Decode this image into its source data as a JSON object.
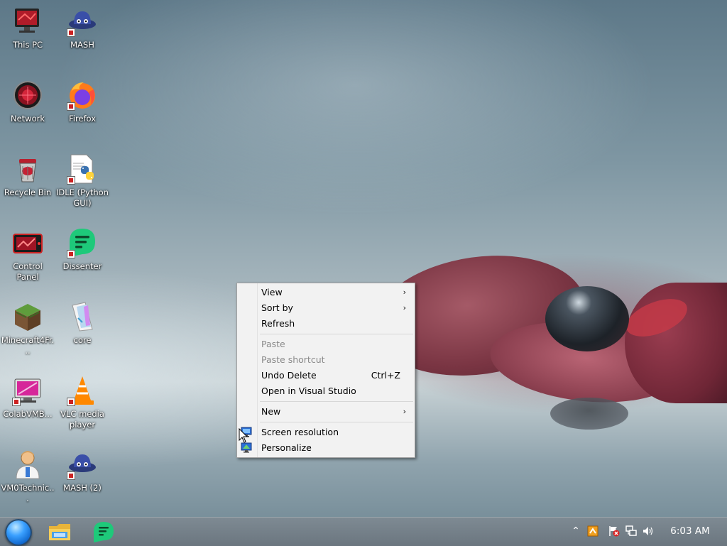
{
  "desktop_icons": [
    {
      "label": "This PC",
      "icon": "this-pc-icon"
    },
    {
      "label": "MASH",
      "icon": "mash-icon"
    },
    {
      "label": "Network",
      "icon": "network-icon"
    },
    {
      "label": "Firefox",
      "icon": "firefox-icon"
    },
    {
      "label": "Recycle Bin",
      "icon": "recycle-bin-icon"
    },
    {
      "label": "IDLE (Python GUI)",
      "icon": "python-idle-icon"
    },
    {
      "label": "Control Panel",
      "icon": "control-panel-icon"
    },
    {
      "label": "Dissenter",
      "icon": "dissenter-icon"
    },
    {
      "label": "Minecraft4Fr...",
      "icon": "minecraft-icon"
    },
    {
      "label": "core",
      "icon": "core-file-icon"
    },
    {
      "label": "ColabVMB...",
      "icon": "colabvm-icon"
    },
    {
      "label": "VLC media player",
      "icon": "vlc-icon"
    },
    {
      "label": "VM0Technic...",
      "icon": "technician-icon"
    },
    {
      "label": "MASH (2)",
      "icon": "mash-2-icon"
    }
  ],
  "context_menu": {
    "view": "View",
    "sort_by": "Sort by",
    "refresh": "Refresh",
    "paste": "Paste",
    "paste_shortcut": "Paste shortcut",
    "undo_delete": "Undo Delete",
    "undo_delete_shortcut": "Ctrl+Z",
    "open_in_vs": "Open in Visual Studio",
    "new": "New",
    "screen_resolution": "Screen resolution",
    "personalize": "Personalize",
    "submenu_arrow": "›"
  },
  "taskbar": {
    "clock": "6:03 AM",
    "pinned": [
      "file-explorer-icon",
      "dissenter-icon"
    ],
    "tray": [
      "show-hidden-icons-icon",
      "update-icon",
      "action-center-flag-icon",
      "network-icon",
      "volume-icon"
    ],
    "tray_chevron": "⌃"
  },
  "colors": {
    "accent": "#0a5fc6",
    "menu_bg": "#f2f2f2",
    "taskbar_bg": "#6b767f",
    "dissenter_green": "#1ec97a"
  }
}
